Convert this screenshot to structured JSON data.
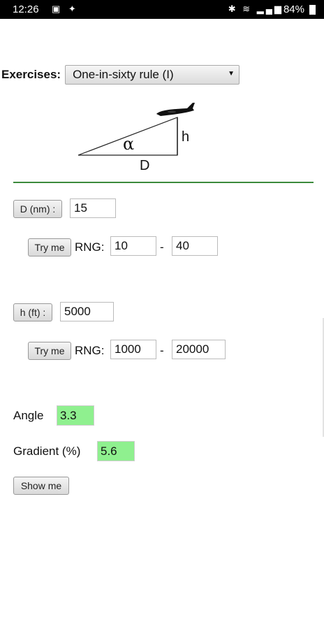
{
  "status_bar": {
    "time": "12:26",
    "left_icons": "▣ ✦",
    "right_icons": "✱ ≋ ▂▄▆",
    "battery": "84%"
  },
  "exercises": {
    "label": "Exercises:",
    "selected": "One-in-sixty rule (I)"
  },
  "diagram": {
    "alpha": "α",
    "h": "h",
    "d": "D"
  },
  "d_section": {
    "button": "D (nm) :",
    "value": "15",
    "try_me": "Try me",
    "rng_label": "RNG:",
    "rng_min": "10",
    "dash": "-",
    "rng_max": "40"
  },
  "h_section": {
    "button": "h (ft) :",
    "value": "5000",
    "try_me": "Try me",
    "rng_label": "RNG:",
    "rng_min": "1000",
    "dash": "-",
    "rng_max": "20000"
  },
  "results": {
    "angle_label": "Angle",
    "angle_value": "3.3",
    "gradient_label": "Gradient (%)",
    "gradient_value": "5.6",
    "show_me": "Show me"
  },
  "colors": {
    "rule": "#3c8a3c",
    "result_bg": "#8ff08f"
  }
}
